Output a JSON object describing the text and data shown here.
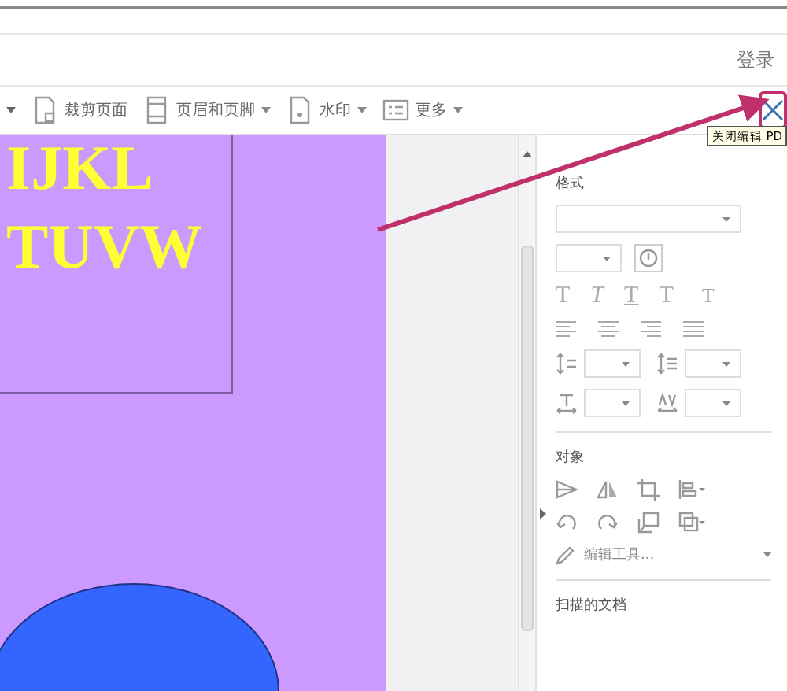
{
  "header": {
    "login": "登录"
  },
  "toolbar": {
    "items": [
      {
        "label": "裁剪页面",
        "dropdown": false
      },
      {
        "label": "页眉和页脚",
        "dropdown": true
      },
      {
        "label": "水印",
        "dropdown": true
      },
      {
        "label": "更多",
        "dropdown": true
      }
    ],
    "close_tooltip": "关闭编辑 PD"
  },
  "document": {
    "lines": [
      "IJKL",
      "TUVW"
    ]
  },
  "panel": {
    "format_title": "格式",
    "text_styles": [
      {
        "glyph": "T",
        "kind": "plain"
      },
      {
        "glyph": "T",
        "kind": "italic"
      },
      {
        "glyph": "T",
        "kind": "underline"
      },
      {
        "glyph": "T",
        "kind": "sup"
      },
      {
        "glyph": "T",
        "kind": "sub"
      }
    ],
    "object_title": "对象",
    "edit_tool": "编辑工具...",
    "scanned_title": "扫描的文档"
  }
}
